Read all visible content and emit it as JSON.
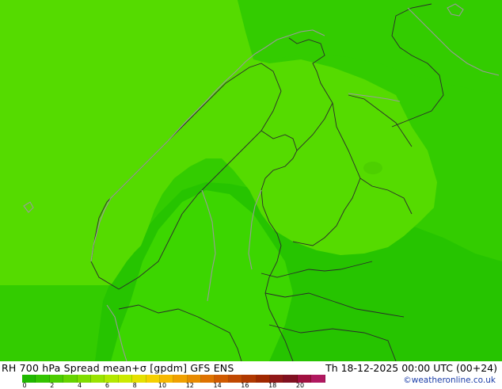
{
  "map": {
    "colors": {
      "sea": "#33cc00",
      "low_spread": "#26c400",
      "mid_spread": "#3cd600",
      "high_spread": "#55db00",
      "peak_spread": "#4dd000",
      "coastline": "#9a9a9a",
      "border": "#2b2b2b"
    }
  },
  "caption": {
    "title": "RH 700 hPa Spread mean+σ [gpdm] GFS ENS",
    "datetime": "Th 18-12-2025 00:00 UTC (00+24)"
  },
  "legend": {
    "colors": [
      "#20b800",
      "#33c400",
      "#4ccc00",
      "#66d400",
      "#80dd00",
      "#99e300",
      "#b3e800",
      "#ccea00",
      "#e6e000",
      "#f5d000",
      "#f7b800",
      "#f0a000",
      "#e88a00",
      "#de7200",
      "#d05a00",
      "#c04800",
      "#b03800",
      "#a02800",
      "#901818",
      "#801020",
      "#a01040",
      "#b01860"
    ],
    "tick_labels": [
      "0",
      "2",
      "4",
      "6",
      "8",
      "10",
      "12",
      "14",
      "16",
      "18",
      "20"
    ]
  },
  "credit": "©weatheronline.co.uk"
}
